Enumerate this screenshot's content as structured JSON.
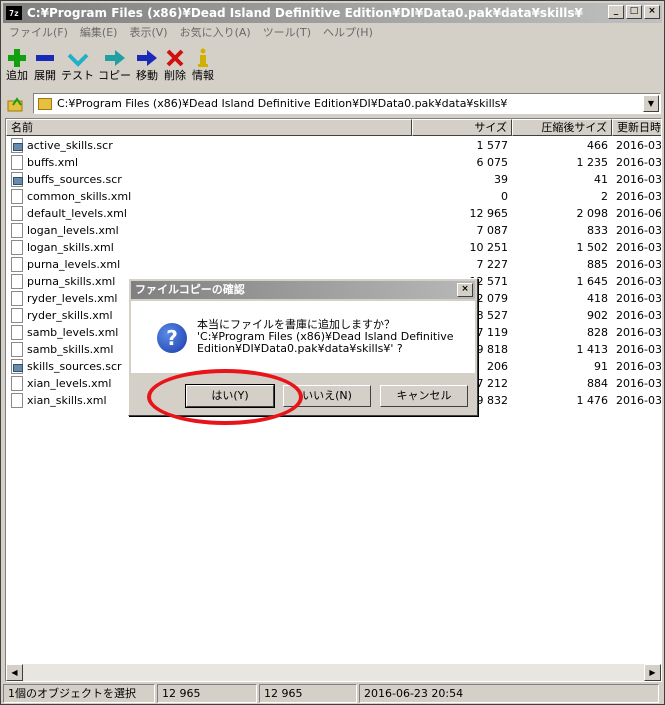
{
  "window": {
    "app_icon_text": "7z",
    "title": "C:¥Program Files (x86)¥Dead Island Definitive Edition¥DI¥Data0.pak¥data¥skills¥",
    "minimize": "_",
    "maximize": "□",
    "close": "×"
  },
  "menu": [
    "ファイル(F)",
    "編集(E)",
    "表示(V)",
    "お気に入り(A)",
    "ツール(T)",
    "ヘルプ(H)"
  ],
  "toolbar": [
    {
      "label": "追加",
      "icon": "plus-icon",
      "color": "#10a010"
    },
    {
      "label": "展開",
      "icon": "minus-icon",
      "color": "#1a2ab8"
    },
    {
      "label": "テスト",
      "icon": "check-icon",
      "color": "#20b0c8"
    },
    {
      "label": "コピー",
      "icon": "copy-arrow-icon",
      "color": "#20a0a0"
    },
    {
      "label": "移動",
      "icon": "move-arrow-icon",
      "color": "#1a2ab8"
    },
    {
      "label": "削除",
      "icon": "delete-x-icon",
      "color": "#d01010"
    },
    {
      "label": "情報",
      "icon": "info-icon",
      "color": "#d0b000"
    }
  ],
  "address": {
    "path": "C:¥Program Files (x86)¥Dead Island Definitive Edition¥DI¥Data0.pak¥data¥skills¥"
  },
  "columns": [
    "名前",
    "サイズ",
    "圧縮後サイズ",
    "更新日時"
  ],
  "files": [
    {
      "name": "active_skills.scr",
      "size": "1 577",
      "packed": "466",
      "modified": "2016-03",
      "sys": true
    },
    {
      "name": "buffs.xml",
      "size": "6 075",
      "packed": "1 235",
      "modified": "2016-03",
      "sys": false
    },
    {
      "name": "buffs_sources.scr",
      "size": "39",
      "packed": "41",
      "modified": "2016-03",
      "sys": true
    },
    {
      "name": "common_skills.xml",
      "size": "0",
      "packed": "2",
      "modified": "2016-03",
      "sys": false
    },
    {
      "name": "default_levels.xml",
      "size": "12 965",
      "packed": "2 098",
      "modified": "2016-06",
      "sys": false
    },
    {
      "name": "logan_levels.xml",
      "size": "7 087",
      "packed": "833",
      "modified": "2016-03",
      "sys": false
    },
    {
      "name": "logan_skills.xml",
      "size": "10 251",
      "packed": "1 502",
      "modified": "2016-03",
      "sys": false
    },
    {
      "name": "purna_levels.xml",
      "size": "7 227",
      "packed": "885",
      "modified": "2016-03",
      "sys": false
    },
    {
      "name": "purna_skills.xml",
      "size": "12 571",
      "packed": "1 645",
      "modified": "2016-03",
      "sys": false
    },
    {
      "name": "ryder_levels.xml",
      "size": "2 079",
      "packed": "418",
      "modified": "2016-03",
      "sys": false
    },
    {
      "name": "ryder_skills.xml",
      "size": "8 527",
      "packed": "902",
      "modified": "2016-03",
      "sys": false
    },
    {
      "name": "samb_levels.xml",
      "size": "7 119",
      "packed": "828",
      "modified": "2016-03",
      "sys": false
    },
    {
      "name": "samb_skills.xml",
      "size": "9 818",
      "packed": "1 413",
      "modified": "2016-03",
      "sys": false
    },
    {
      "name": "skills_sources.scr",
      "size": "206",
      "packed": "91",
      "modified": "2016-03",
      "sys": true
    },
    {
      "name": "xian_levels.xml",
      "size": "7 212",
      "packed": "884",
      "modified": "2016-03",
      "sys": false
    },
    {
      "name": "xian_skills.xml",
      "size": "9 832",
      "packed": "1 476",
      "modified": "2016-03",
      "sys": false
    }
  ],
  "status": {
    "selected": "1個のオブジェクトを選択",
    "size": "12 965",
    "packed": "12 965",
    "modified": "2016-06-23 20:54"
  },
  "dialog": {
    "title": "ファイルコピーの確認",
    "close": "×",
    "line1": "本当にファイルを書庫に追加しますか？",
    "line2": "'C:¥Program Files (x86)¥Dead Island Definitive",
    "line3": "Edition¥DI¥Data0.pak¥data¥skills¥' ?",
    "yes": "はい(Y)",
    "no": "いいえ(N)",
    "cancel": "キャンセル",
    "annotation_color": "#e8141a"
  }
}
